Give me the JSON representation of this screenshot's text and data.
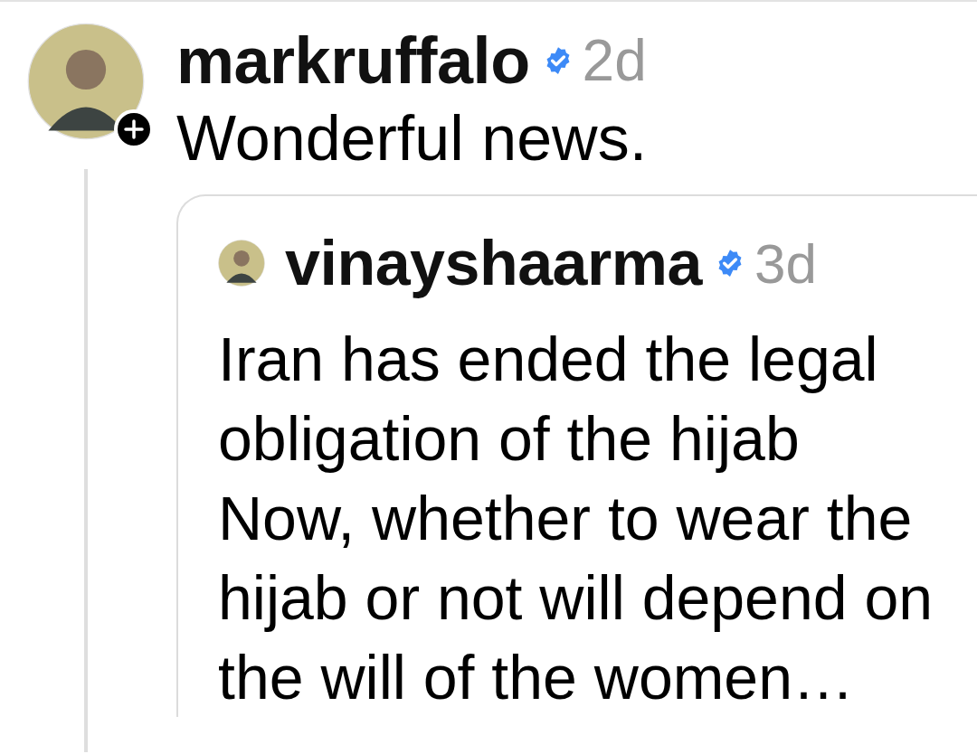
{
  "post": {
    "username": "markruffalo",
    "verified": true,
    "time": "2d",
    "text": "Wonderful news.",
    "quote": {
      "username": "vinayshaarma",
      "verified": true,
      "time": "3d",
      "text": "Iran has ended the legal obligation of the hijab\nNow, whether to wear the hijab or not will depend on the will of the women…"
    }
  }
}
